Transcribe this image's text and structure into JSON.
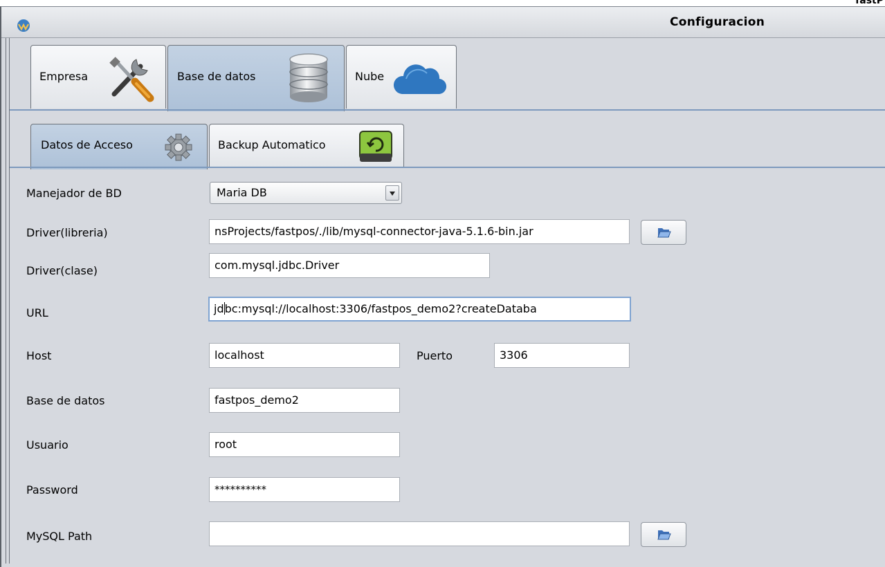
{
  "corner_text": "fastP",
  "window": {
    "title": "Configuracion"
  },
  "main_tabs": [
    {
      "label": "Empresa",
      "icon": "tools-icon"
    },
    {
      "label": "Base de datos",
      "icon": "database-icon",
      "selected": true
    },
    {
      "label": "Nube",
      "icon": "cloud-icon"
    }
  ],
  "sub_tabs": [
    {
      "label": "Datos de Acceso",
      "icon": "gear-icon",
      "selected": true
    },
    {
      "label": "Backup Automatico",
      "icon": "backup-drive-icon"
    }
  ],
  "form": {
    "manager": {
      "label": "Manejador de BD",
      "value": "Maria DB"
    },
    "driver_lib": {
      "label": "Driver(libreria)",
      "value": "nsProjects/fastpos/./lib/mysql-connector-java-5.1.6-bin.jar"
    },
    "driver_class": {
      "label": "Driver(clase)",
      "value": "com.mysql.jdbc.Driver"
    },
    "url": {
      "label": "URL",
      "value_before_caret": "jd",
      "value_after_caret": "bc:mysql://localhost:3306/fastpos_demo2?createDataba"
    },
    "host": {
      "label": "Host",
      "value": "localhost"
    },
    "port": {
      "label": "Puerto",
      "value": "3306"
    },
    "database": {
      "label": "Base de datos",
      "value": "fastpos_demo2"
    },
    "user": {
      "label": "Usuario",
      "value": "root"
    },
    "password": {
      "label": "Password",
      "value": "**********"
    },
    "mysql_path": {
      "label": "MySQL Path",
      "value": ""
    }
  },
  "colors": {
    "window_bg": "#d6d9df",
    "selected_tab": "#adc1d8",
    "focus_border": "#7fa3d1"
  }
}
